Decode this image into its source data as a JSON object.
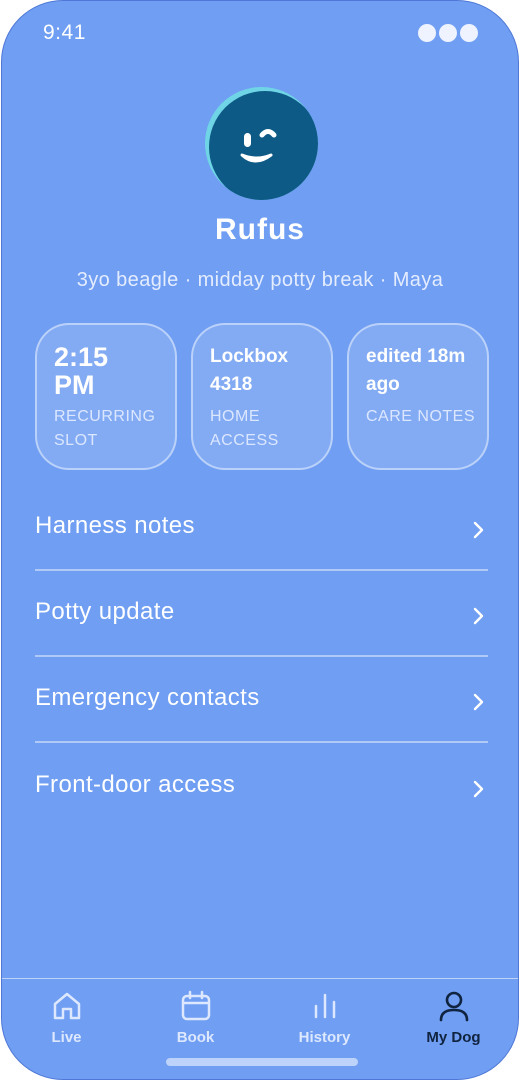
{
  "status_bar": {
    "time": "9:41"
  },
  "profile": {
    "name": "Rufus",
    "subtitle": "3yo beagle · midday potty break · Maya"
  },
  "tiles": [
    {
      "value": "2:15 PM",
      "label": "RECURRING SLOT"
    },
    {
      "value": "Lockbox 4318",
      "label": "HOME ACCESS"
    },
    {
      "value": "edited 18m ago",
      "label": "CARE NOTES"
    }
  ],
  "menu": [
    {
      "label": "Harness notes"
    },
    {
      "label": "Potty update"
    },
    {
      "label": "Emergency contacts"
    },
    {
      "label": "Front-door access"
    }
  ],
  "tabbar": {
    "active": "My Dog",
    "tabs": [
      {
        "label": "Live",
        "icon": "home-icon"
      },
      {
        "label": "Book",
        "icon": "calendar-icon"
      },
      {
        "label": "History",
        "icon": "bar-chart-icon"
      },
      {
        "label": "My Dog",
        "icon": "person-icon"
      }
    ]
  },
  "colors": {
    "background": "#6f9ef2",
    "avatar_ring": "#6fd4e6",
    "avatar_face": "#0e5a86",
    "active_tab": "#10233f"
  }
}
